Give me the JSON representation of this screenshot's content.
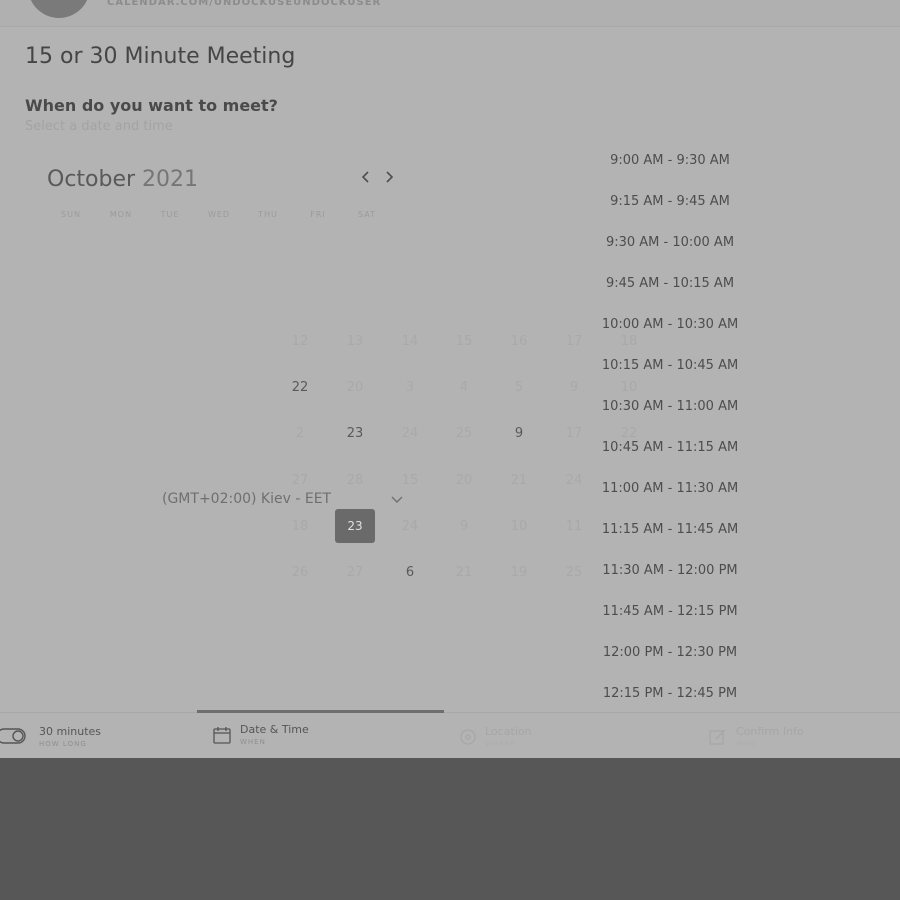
{
  "header": {
    "url": "CALENDAR.COM/UNDOCKUSEUNDOCKUSER"
  },
  "event": {
    "title": "15 or 30 Minute Meeting",
    "question": "When do you want to meet?",
    "subtitle": "Select a date and time"
  },
  "calendar": {
    "month": "October",
    "year": "2021",
    "prev_icon": "chevron-left-icon",
    "next_icon": "chevron-right-icon",
    "weekdays": [
      "SUN",
      "MON",
      "TUE",
      "WED",
      "THU",
      "FRI",
      "SAT"
    ],
    "days": {
      "r1": [
        "12",
        "13",
        "14",
        "15",
        "16",
        "17",
        "18"
      ],
      "r2": [
        "22",
        "20",
        "3",
        "4",
        "5",
        "9",
        "10"
      ],
      "r3": [
        "2",
        "23",
        "24",
        "25",
        "9",
        "17",
        "22"
      ],
      "r4": [
        "27",
        "28",
        "15",
        "20",
        "21",
        "24"
      ],
      "r5": [
        "18",
        "23",
        "24",
        "9",
        "10",
        "11"
      ],
      "r6": [
        "26",
        "27",
        "6",
        "21",
        "19",
        "25"
      ]
    },
    "selected_day": "23"
  },
  "timezone": {
    "label": "(GMT+02:00) Kiev - EET",
    "icon": "chevron-down-icon"
  },
  "slots": [
    "9:00 AM - 9:30 AM",
    "9:15 AM - 9:45 AM",
    "9:30 AM - 10:00 AM",
    "9:45 AM - 10:15 AM",
    "10:00 AM - 10:30 AM",
    "10:15 AM - 10:45 AM",
    "10:30 AM - 11:00 AM",
    "10:45 AM - 11:15 AM",
    "11:00 AM - 11:30 AM",
    "11:15 AM - 11:45 AM",
    "11:30 AM - 12:00 PM",
    "11:45 AM - 12:15 PM",
    "12:00 PM - 12:30 PM",
    "12:15 PM - 12:45 PM"
  ],
  "tabs": [
    {
      "label": "30 minutes",
      "sub": "HOW LONG",
      "icon": "toggle-icon"
    },
    {
      "label": "Date & Time",
      "sub": "WHEN",
      "icon": "calendar-icon"
    },
    {
      "label": "Location",
      "sub": "WHERE",
      "icon": "location-icon"
    },
    {
      "label": "Confirm Info",
      "sub": "WHO",
      "icon": "edit-icon"
    }
  ]
}
